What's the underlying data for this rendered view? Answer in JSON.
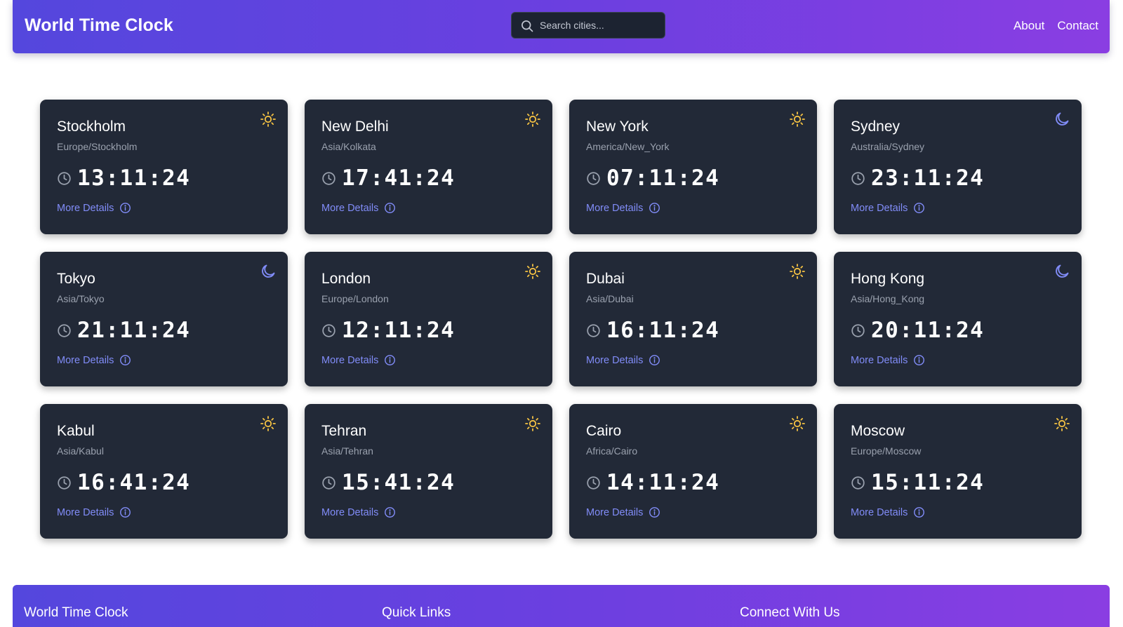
{
  "header": {
    "title": "World Time Clock",
    "search_placeholder": "Search cities...",
    "nav": [
      "About",
      "Contact"
    ]
  },
  "cards": [
    {
      "city": "Stockholm",
      "tz": "Europe/Stockholm",
      "time": "13:11:24",
      "icon": "sun-icon",
      "details": "More Details"
    },
    {
      "city": "New Delhi",
      "tz": "Asia/Kolkata",
      "time": "17:41:24",
      "icon": "sun-icon",
      "details": "More Details"
    },
    {
      "city": "New York",
      "tz": "America/New_York",
      "time": "07:11:24",
      "icon": "sun-icon",
      "details": "More Details"
    },
    {
      "city": "Sydney",
      "tz": "Australia/Sydney",
      "time": "23:11:24",
      "icon": "moon-icon",
      "details": "More Details"
    },
    {
      "city": "Tokyo",
      "tz": "Asia/Tokyo",
      "time": "21:11:24",
      "icon": "moon-icon",
      "details": "More Details"
    },
    {
      "city": "London",
      "tz": "Europe/London",
      "time": "12:11:24",
      "icon": "sun-icon",
      "details": "More Details"
    },
    {
      "city": "Dubai",
      "tz": "Asia/Dubai",
      "time": "16:11:24",
      "icon": "sun-icon",
      "details": "More Details"
    },
    {
      "city": "Hong Kong",
      "tz": "Asia/Hong_Kong",
      "time": "20:11:24",
      "icon": "moon-icon",
      "details": "More Details"
    },
    {
      "city": "Kabul",
      "tz": "Asia/Kabul",
      "time": "16:41:24",
      "icon": "sun-icon",
      "details": "More Details"
    },
    {
      "city": "Tehran",
      "tz": "Asia/Tehran",
      "time": "15:41:24",
      "icon": "sun-icon",
      "details": "More Details"
    },
    {
      "city": "Cairo",
      "tz": "Africa/Cairo",
      "time": "14:11:24",
      "icon": "sun-icon",
      "details": "More Details"
    },
    {
      "city": "Moscow",
      "tz": "Europe/Moscow",
      "time": "15:11:24",
      "icon": "sun-icon",
      "details": "More Details"
    }
  ],
  "footer": {
    "headings": [
      "World Time Clock",
      "Quick Links",
      "Connect With Us"
    ]
  },
  "colors": {
    "header_gradient_start": "#5447dd",
    "header_gradient_end": "#8a3ee2",
    "card_bg": "#222937",
    "link": "#818cf8",
    "sun": "#f6c343",
    "moon": "#818cf8"
  }
}
